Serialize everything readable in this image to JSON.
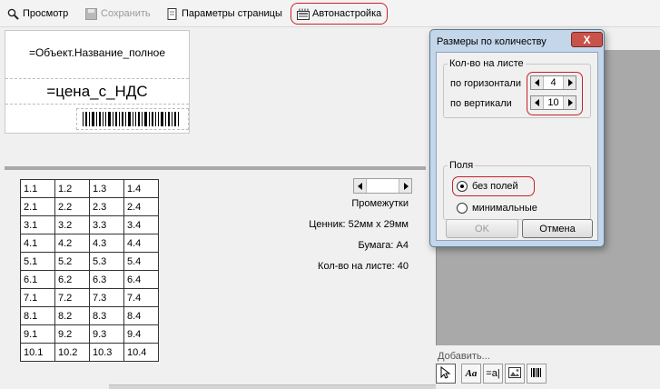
{
  "toolbar": {
    "preview": "Просмотр",
    "save": "Сохранить",
    "page_params": "Параметры страницы",
    "autosetup": "Автонастройка"
  },
  "label": {
    "object_name": "=Объект.Название_полное",
    "price": "=цена_с_НДС",
    "barcode_icon": "barcode-icon"
  },
  "grid": {
    "rows": [
      [
        "1.1",
        "1.2",
        "1.3",
        "1.4"
      ],
      [
        "2.1",
        "2.2",
        "2.3",
        "2.4"
      ],
      [
        "3.1",
        "3.2",
        "3.3",
        "3.4"
      ],
      [
        "4.1",
        "4.2",
        "4.3",
        "4.4"
      ],
      [
        "5.1",
        "5.2",
        "5.3",
        "5.4"
      ],
      [
        "6.1",
        "6.2",
        "6.3",
        "6.4"
      ],
      [
        "7.1",
        "7.2",
        "7.3",
        "7.4"
      ],
      [
        "8.1",
        "8.2",
        "8.3",
        "8.4"
      ],
      [
        "9.1",
        "9.2",
        "9.3",
        "9.4"
      ],
      [
        "10.1",
        "10.2",
        "10.3",
        "10.4"
      ]
    ]
  },
  "info": {
    "spacing": "Промежутки",
    "tag_size": "Ценник: 52мм x 29мм",
    "paper": "Бумага: A4",
    "per_sheet": "Кол-во на листе: 40"
  },
  "dialog": {
    "title": "Размеры по количеству",
    "close": "X",
    "count_group": "Кол-во на листе",
    "horizontal_label": "по горизонтали",
    "horizontal_value": "4",
    "vertical_label": "по вертикали",
    "vertical_value": "10",
    "margins_group": "Поля",
    "no_margins": "без полей",
    "minimal": "минимальные",
    "ok": "OK",
    "cancel": "Отмена"
  },
  "add_panel": {
    "label": "Добавить...",
    "tools": [
      "pointer-icon",
      "text-icon",
      "field-icon",
      "image-icon",
      "barcode-icon"
    ]
  },
  "colors": {
    "highlight": "#c8202a",
    "dialog_frame": "#c3d6ea",
    "close_button": "#c7534a",
    "preview_gray": "#a9a9a9"
  }
}
